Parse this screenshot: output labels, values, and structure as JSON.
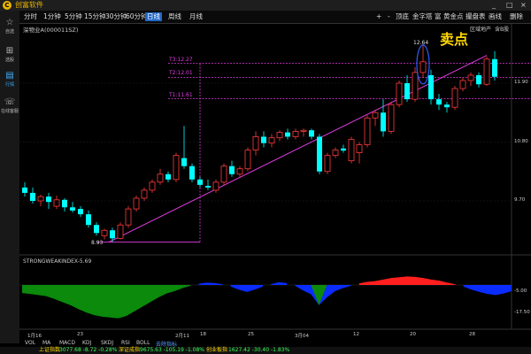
{
  "app": {
    "title": "创富软件",
    "logo": "C",
    "controls": [
      "_",
      "□",
      "×"
    ]
  },
  "sidebar": {
    "items": [
      {
        "icon": "star-icon",
        "label": "自选",
        "glyph": "☆"
      },
      {
        "icon": "grid-icon",
        "label": "选股",
        "glyph": "⊞"
      },
      {
        "icon": "chart-icon",
        "label": "行情",
        "glyph": "▤"
      },
      {
        "icon": "phone-icon",
        "label": "在线客服",
        "glyph": "☏"
      }
    ]
  },
  "toolbar": {
    "periods": [
      "分时",
      "1分钟",
      "5分钟",
      "15分钟",
      "30分钟",
      "60分钟",
      "日线",
      "周线",
      "月线"
    ],
    "active_period": "日线",
    "tools": [
      "+",
      "-",
      "顶底",
      "金字塔",
      "富",
      "黄金点",
      "撮盘表",
      "画线",
      "删除"
    ]
  },
  "stock": {
    "name": "深物业A(000011SZ)",
    "sector": "区域地产",
    "option": "含B股"
  },
  "signal": {
    "sell_label": "卖点",
    "peak_price": "12.64"
  },
  "levels": [
    {
      "label": "T3:12.27",
      "value": 12.27
    },
    {
      "label": "T2:12.01",
      "value": 12.01
    },
    {
      "label": "T1:11.61",
      "value": 11.61
    }
  ],
  "low_label": "8.93",
  "price_axis": [
    "11.90",
    "10.80",
    "9.70"
  ],
  "indicator": {
    "title": "STRONGWEAKINDEX-5.69",
    "axis": [
      "-5.00",
      "-17.50"
    ]
  },
  "dates": [
    "1月16",
    "23",
    "2月11",
    "18",
    "25",
    "3月04",
    "12",
    "20",
    "28"
  ],
  "indicator_tabs": [
    "VOL",
    "MA",
    "MACD",
    "KDJ",
    "SKDJ",
    "RSI",
    "BOLL",
    "去除指标"
  ],
  "status": [
    {
      "label": "上证指数",
      "value": "3077.68 -8.72 -0.28%"
    },
    {
      "label": "深证成指",
      "value": "9675.63 -105.19 -1.08%"
    },
    {
      "label": "创业板指",
      "value": "1627.42 -30.40 -1.83%"
    }
  ],
  "colors": {
    "up": "#ff3b3b",
    "down": "#00ffff",
    "accent": "#e03ce0",
    "sell": "#ffd700",
    "pos_fill": "#0a2cff",
    "neg_fill": "#0b8a0b",
    "top_fill": "#ff1f1f"
  },
  "chart_data": {
    "type": "candlestick",
    "title": "深物业A(000011SZ)",
    "y_ticks": [
      9.7,
      10.8,
      11.9
    ],
    "candles": [
      {
        "o": 9.95,
        "h": 10.05,
        "l": 9.78,
        "c": 9.85
      },
      {
        "o": 9.85,
        "h": 9.95,
        "l": 9.65,
        "c": 9.7
      },
      {
        "o": 9.7,
        "h": 9.82,
        "l": 9.6,
        "c": 9.78
      },
      {
        "o": 9.78,
        "h": 9.85,
        "l": 9.55,
        "c": 9.68
      },
      {
        "o": 9.6,
        "h": 9.8,
        "l": 9.55,
        "c": 9.72
      },
      {
        "o": 9.72,
        "h": 9.75,
        "l": 9.5,
        "c": 9.58
      },
      {
        "o": 9.58,
        "h": 9.68,
        "l": 9.48,
        "c": 9.52
      },
      {
        "o": 9.55,
        "h": 9.6,
        "l": 9.4,
        "c": 9.45
      },
      {
        "o": 9.45,
        "h": 9.52,
        "l": 9.2,
        "c": 9.25
      },
      {
        "o": 9.25,
        "h": 9.3,
        "l": 9.05,
        "c": 9.1
      },
      {
        "o": 9.05,
        "h": 9.18,
        "l": 8.98,
        "c": 9.15
      },
      {
        "o": 9.15,
        "h": 9.2,
        "l": 8.93,
        "c": 9.0
      },
      {
        "o": 9.0,
        "h": 9.3,
        "l": 8.98,
        "c": 9.25
      },
      {
        "o": 9.25,
        "h": 9.6,
        "l": 9.2,
        "c": 9.55
      },
      {
        "o": 9.55,
        "h": 9.8,
        "l": 9.5,
        "c": 9.75
      },
      {
        "o": 9.75,
        "h": 9.95,
        "l": 9.7,
        "c": 9.9
      },
      {
        "o": 9.9,
        "h": 10.1,
        "l": 9.85,
        "c": 10.05
      },
      {
        "o": 10.05,
        "h": 10.3,
        "l": 10.0,
        "c": 10.2
      },
      {
        "o": 10.2,
        "h": 10.25,
        "l": 10.05,
        "c": 10.1
      },
      {
        "o": 10.1,
        "h": 10.6,
        "l": 10.05,
        "c": 10.55
      },
      {
        "o": 10.5,
        "h": 11.1,
        "l": 10.3,
        "c": 10.35
      },
      {
        "o": 10.35,
        "h": 10.4,
        "l": 10.05,
        "c": 10.1
      },
      {
        "o": 10.1,
        "h": 10.15,
        "l": 9.95,
        "c": 10.0
      },
      {
        "o": 9.98,
        "h": 10.1,
        "l": 9.9,
        "c": 9.95
      },
      {
        "o": 9.9,
        "h": 10.1,
        "l": 9.85,
        "c": 10.05
      },
      {
        "o": 10.05,
        "h": 10.4,
        "l": 10.0,
        "c": 10.35
      },
      {
        "o": 10.35,
        "h": 10.45,
        "l": 10.15,
        "c": 10.2
      },
      {
        "o": 10.2,
        "h": 10.35,
        "l": 10.15,
        "c": 10.3
      },
      {
        "o": 10.3,
        "h": 10.7,
        "l": 10.25,
        "c": 10.65
      },
      {
        "o": 10.65,
        "h": 11.0,
        "l": 10.55,
        "c": 10.9
      },
      {
        "o": 10.9,
        "h": 11.0,
        "l": 10.7,
        "c": 10.78
      },
      {
        "o": 10.78,
        "h": 10.95,
        "l": 10.7,
        "c": 10.88
      },
      {
        "o": 10.88,
        "h": 11.02,
        "l": 10.82,
        "c": 10.98
      },
      {
        "o": 10.98,
        "h": 11.05,
        "l": 10.85,
        "c": 10.9
      },
      {
        "o": 10.9,
        "h": 11.05,
        "l": 10.85,
        "c": 11.0
      },
      {
        "o": 11.0,
        "h": 11.05,
        "l": 10.9,
        "c": 11.02
      },
      {
        "o": 11.02,
        "h": 11.05,
        "l": 10.85,
        "c": 10.9
      },
      {
        "o": 10.9,
        "h": 10.95,
        "l": 10.2,
        "c": 10.25
      },
      {
        "o": 10.25,
        "h": 10.6,
        "l": 10.2,
        "c": 10.55
      },
      {
        "o": 10.55,
        "h": 10.7,
        "l": 10.5,
        "c": 10.65
      },
      {
        "o": 10.68,
        "h": 10.75,
        "l": 10.6,
        "c": 10.64
      },
      {
        "o": 10.45,
        "h": 10.9,
        "l": 10.4,
        "c": 10.85
      },
      {
        "o": 10.6,
        "h": 10.8,
        "l": 10.4,
        "c": 10.75
      },
      {
        "o": 10.75,
        "h": 11.3,
        "l": 10.7,
        "c": 11.25
      },
      {
        "o": 11.25,
        "h": 11.4,
        "l": 11.1,
        "c": 11.35
      },
      {
        "o": 11.35,
        "h": 11.6,
        "l": 10.9,
        "c": 11.0
      },
      {
        "o": 11.0,
        "h": 11.55,
        "l": 10.95,
        "c": 11.5
      },
      {
        "o": 11.5,
        "h": 11.95,
        "l": 11.45,
        "c": 11.9
      },
      {
        "o": 11.9,
        "h": 12.05,
        "l": 11.55,
        "c": 11.6
      },
      {
        "o": 11.6,
        "h": 12.2,
        "l": 11.55,
        "c": 12.1
      },
      {
        "o": 12.1,
        "h": 12.64,
        "l": 12.0,
        "c": 12.3
      },
      {
        "o": 12.05,
        "h": 12.15,
        "l": 11.5,
        "c": 11.6
      },
      {
        "o": 11.6,
        "h": 11.7,
        "l": 11.4,
        "c": 11.5
      },
      {
        "o": 11.5,
        "h": 11.55,
        "l": 11.35,
        "c": 11.45
      },
      {
        "o": 11.45,
        "h": 11.85,
        "l": 11.4,
        "c": 11.8
      },
      {
        "o": 11.8,
        "h": 12.0,
        "l": 11.75,
        "c": 11.95
      },
      {
        "o": 11.95,
        "h": 12.1,
        "l": 11.85,
        "c": 12.05
      },
      {
        "o": 12.05,
        "h": 12.1,
        "l": 11.82,
        "c": 11.88
      },
      {
        "o": 11.88,
        "h": 12.4,
        "l": 11.85,
        "c": 12.35
      },
      {
        "o": 12.35,
        "h": 12.5,
        "l": 11.95,
        "c": 12.02
      }
    ],
    "indicator_series": [
      -5.2,
      -5.8,
      -6.5,
      -7.2,
      -9,
      -11,
      -13,
      -15.5,
      -17.8,
      -19.5,
      -20.5,
      -21,
      -21.5,
      -20,
      -17,
      -14,
      -11,
      -8,
      -5.5,
      -4,
      -2,
      -0.5,
      0.8,
      1.5,
      1.2,
      0.5,
      -1,
      -3,
      -4.5,
      -3,
      -1,
      0.5,
      1.8,
      1.2,
      -0.5,
      -3.5,
      -6,
      -13,
      -8,
      -4,
      -2,
      -0.5,
      1,
      2,
      2.5,
      3.5,
      4.5,
      5,
      5.5,
      5.2,
      4.5,
      3.5,
      2.8,
      1.5,
      0.5,
      -1,
      -3,
      -4.5,
      -5.8,
      -6.5,
      -5.5,
      -4
    ]
  }
}
